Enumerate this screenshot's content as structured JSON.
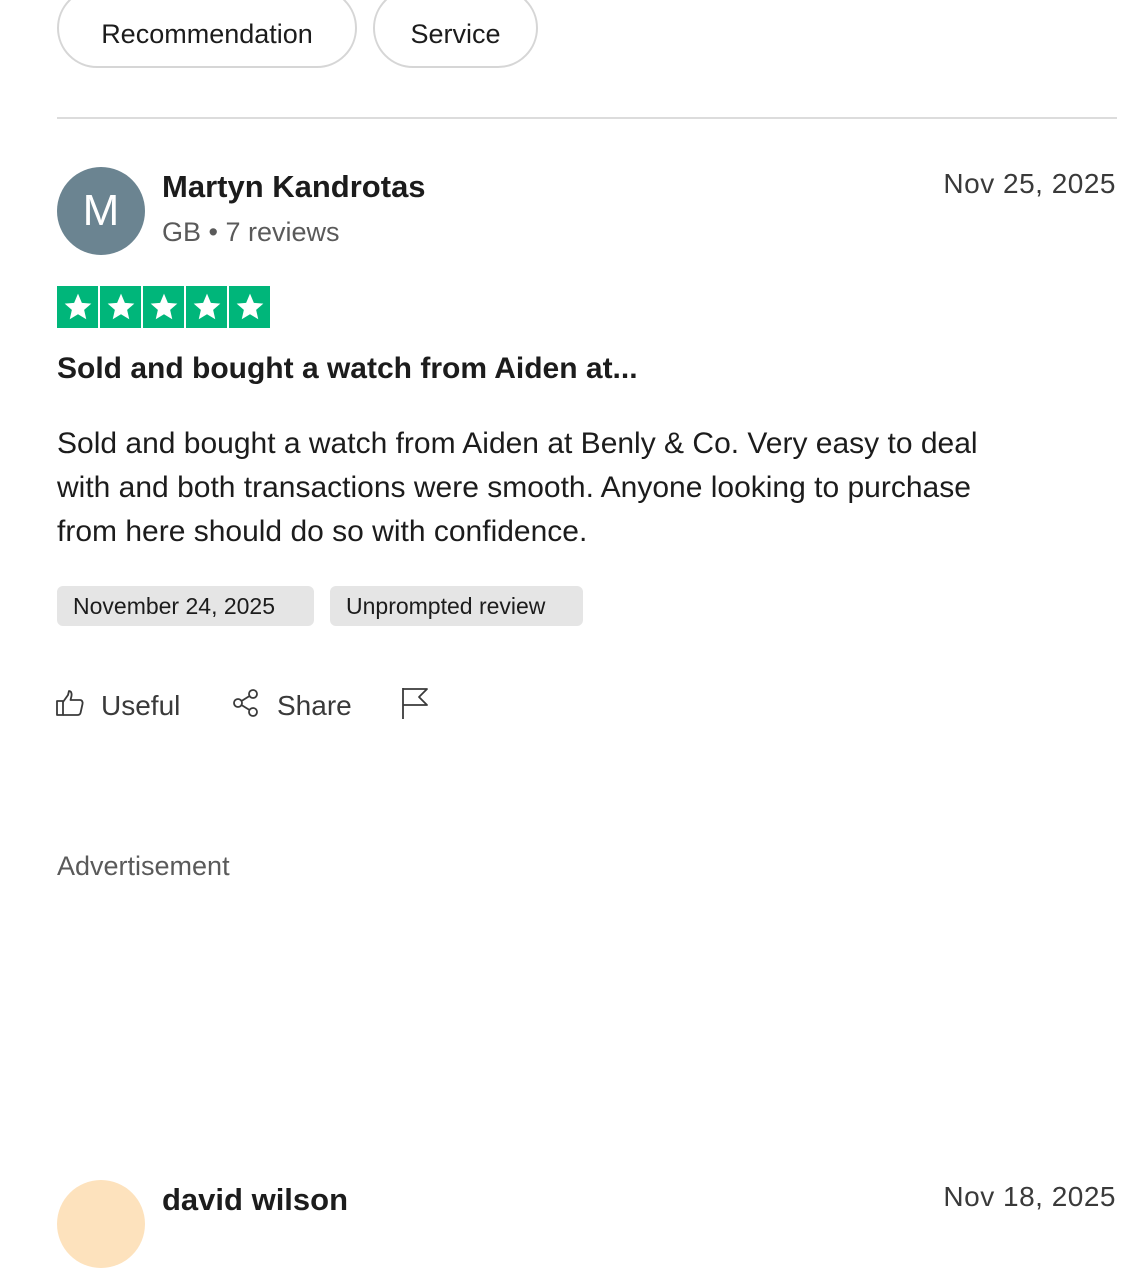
{
  "filters": {
    "chips": [
      "Recommendation",
      "Service"
    ]
  },
  "review": {
    "avatar_initial": "M",
    "avatar_color": "#6b8491",
    "reviewer_name": "Martyn Kandrotas",
    "country": "GB",
    "review_count": "7 reviews",
    "meta_separator": "•",
    "date": "Nov 25, 2025",
    "rating": 5,
    "max_rating": 5,
    "star_color": "#00b67a",
    "title": "Sold and bought a watch from Aiden at...",
    "body": "Sold and bought a watch from Aiden at Benly & Co. Very easy to deal with and both transactions were smooth. Anyone looking to purchase from here should do so with confidence.",
    "tags": {
      "experience_date": "November 24, 2025",
      "review_type": "Unprompted review"
    },
    "actions": {
      "useful_label": "Useful",
      "share_label": "Share"
    }
  },
  "advertisement": {
    "label": "Advertisement"
  },
  "next_review": {
    "avatar_color": "#fde2bd",
    "reviewer_name": "david wilson",
    "date": "Nov 18, 2025"
  },
  "icons": {
    "useful": "thumbs-up-icon",
    "share": "share-icon",
    "report": "flag-icon",
    "star": "star-icon"
  }
}
